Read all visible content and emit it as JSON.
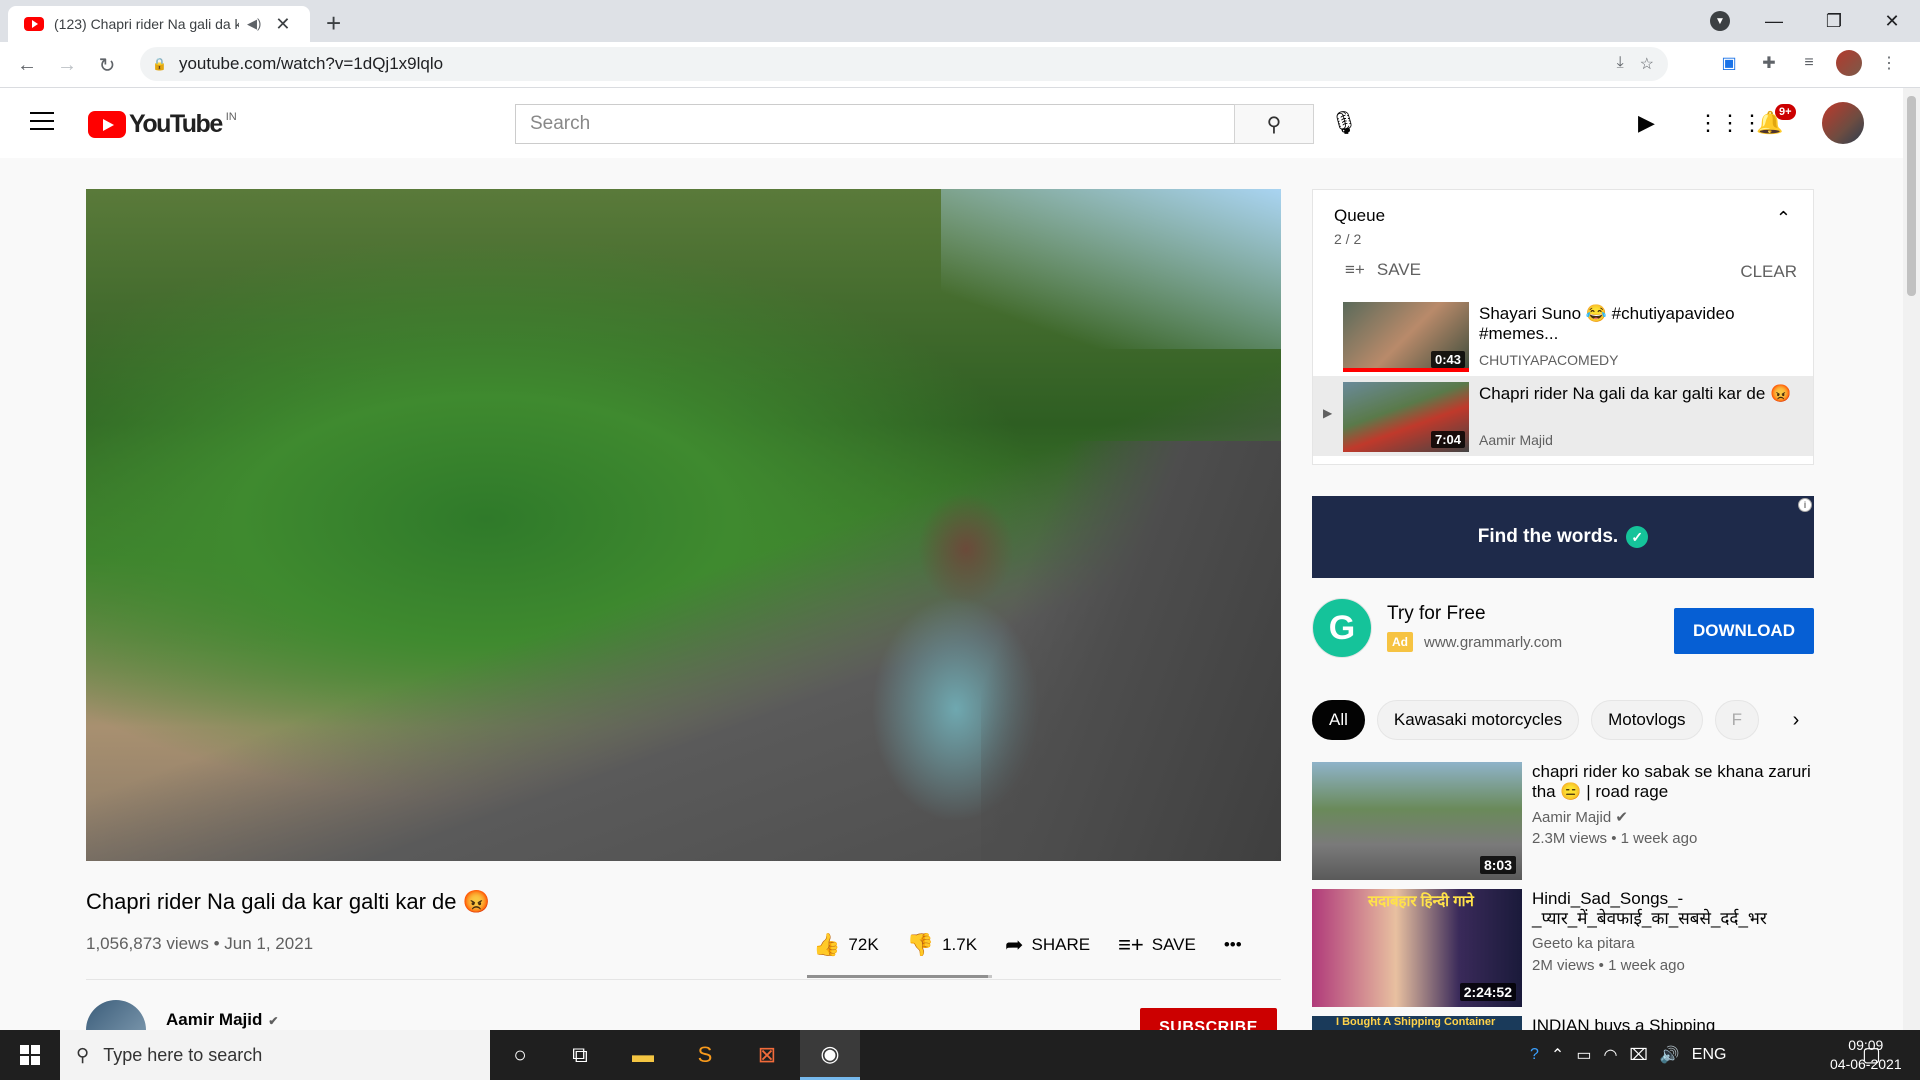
{
  "browser": {
    "tab_title": "(123) Chapri rider Na gali da kar galti kar de",
    "tab_audio_icon": "speaker-icon",
    "new_tab": "+",
    "url": "youtube.com/watch?v=1dQj1x9lqlo"
  },
  "youtube": {
    "logo_text": "YouTube",
    "country_code": "IN",
    "search_placeholder": "Search",
    "notification_count": "9+"
  },
  "video": {
    "title": "Chapri rider Na gali da kar galti kar de 😡",
    "meta": "1,056,873 views • Jun 1, 2021",
    "likes": "72K",
    "dislikes": "1.7K",
    "like_ratio": 0.977,
    "share_label": "SHARE",
    "save_label": "SAVE",
    "more_label": "•••",
    "channel_name": "Aamir Majid",
    "subscribe_label": "SUBSCRIBE"
  },
  "queue": {
    "title": "Queue",
    "count": "2 / 2",
    "save_label": "SAVE",
    "clear_label": "CLEAR",
    "items": [
      {
        "title": "Shayari Suno 😂 #chutiyapavideo #memes...",
        "channel": "CHUTIYAPACOMEDY",
        "duration": "0:43",
        "watched": 1.0
      },
      {
        "title": "Chapri rider Na gali da kar galti kar de 😡",
        "channel": "Aamir Majid",
        "duration": "7:04",
        "watched": 0
      }
    ]
  },
  "ad": {
    "banner_text": "Find the words.",
    "logo_letter": "G",
    "headline": "Try for Free",
    "badge": "Ad",
    "domain": "www.grammarly.com",
    "cta": "DOWNLOAD"
  },
  "chips": [
    "All",
    "Kawasaki motorcycles",
    "Motovlogs",
    "F"
  ],
  "recommendations": [
    {
      "title": "chapri rider ko sabak se khana zaruri tha 😑 | road rage",
      "channel": "Aamir Majid",
      "meta": "2.3M views • 1 week ago",
      "duration": "8:03"
    },
    {
      "title": "Hindi_Sad_Songs_-_प्यार_में_बेवफाई_का_सबसे_दर्द_भर",
      "channel": "Geeto ka pitara",
      "meta": "2M views • 1 week ago",
      "duration": "2:24:52",
      "thumb_text": "सदाबहार हिन्दी गाने"
    },
    {
      "title": "INDIAN buys a Shipping",
      "thumb_text": "I Bought A Shipping Container"
    }
  ],
  "taskbar": {
    "search_placeholder": "Type here to search",
    "language": "ENG",
    "time": "09:09",
    "date": "04-06-2021"
  },
  "colors": {
    "youtube_red": "#ff0000",
    "subscribe_red": "#cc0000",
    "download_blue": "#065fd4",
    "grammarly_green": "#15c39a"
  }
}
